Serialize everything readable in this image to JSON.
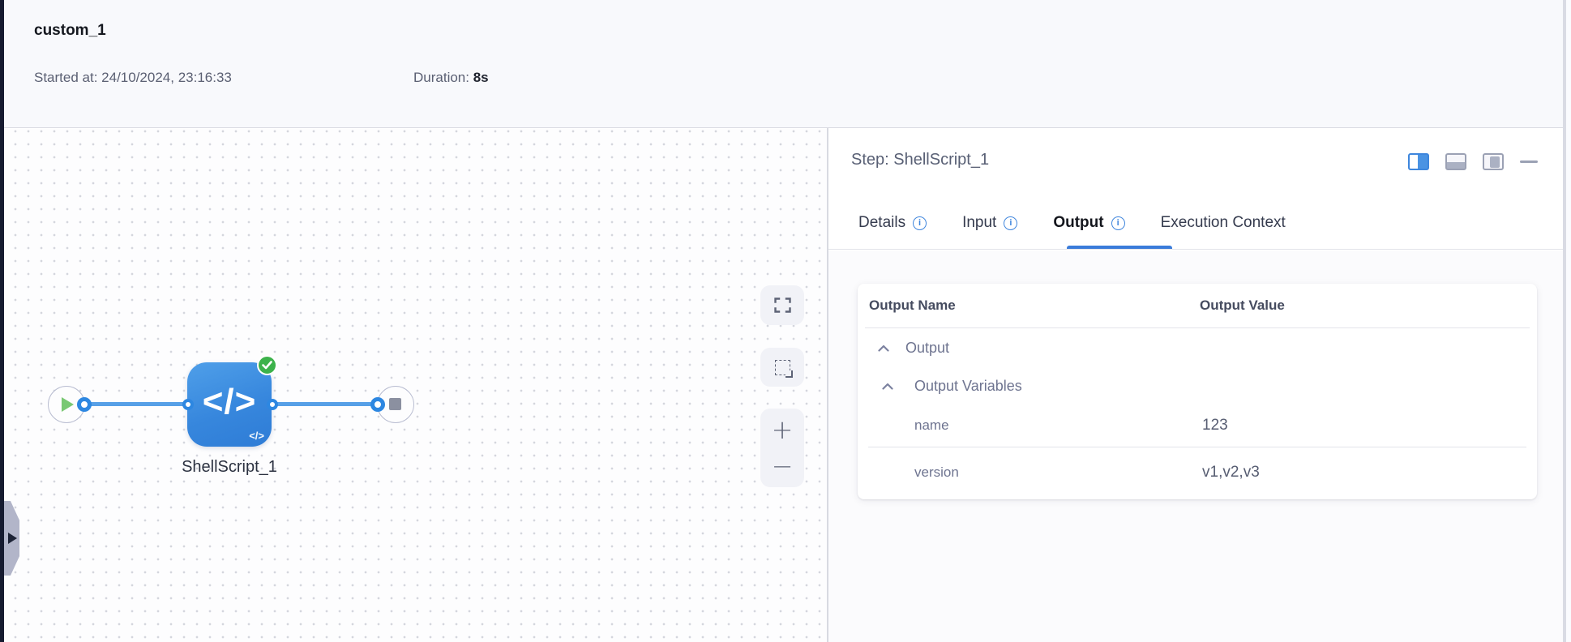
{
  "header": {
    "title": "custom_1",
    "started_label": "Started at:",
    "started_value": "24/10/2024, 23:16:33",
    "duration_label": "Duration:",
    "duration_value": "8s"
  },
  "canvas": {
    "node_label": "ShellScript_1",
    "node_icon_glyph": "</>",
    "node_watermark_glyph": "</>",
    "zoom_in_glyph": "+",
    "zoom_out_glyph": "−"
  },
  "panel": {
    "title": "Step: ShellScript_1",
    "info_glyph": "i",
    "tabs": [
      {
        "label": "Details"
      },
      {
        "label": "Input"
      },
      {
        "label": "Output"
      },
      {
        "label": "Execution Context"
      }
    ],
    "active_tab": "Output",
    "table": {
      "col_name": "Output Name",
      "col_value": "Output Value",
      "groups": [
        {
          "label": "Output"
        },
        {
          "label": "Output Variables"
        }
      ],
      "rows": [
        {
          "name": "name",
          "value": "123"
        },
        {
          "name": "version",
          "value": "v1,v2,v3"
        }
      ]
    }
  },
  "colors": {
    "accent_blue": "#3a7bda",
    "edge_blue": "#57a0e7",
    "node_blue": "#3787dd",
    "success_green": "#3cb24b",
    "dark_strip": "#161b30"
  }
}
